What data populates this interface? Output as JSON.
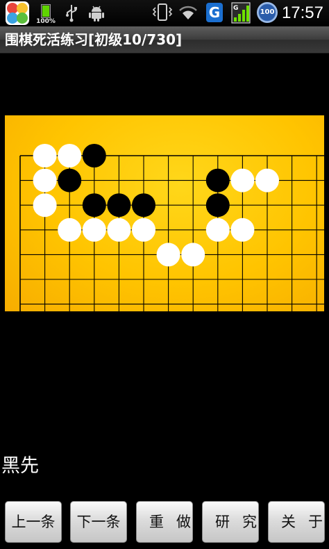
{
  "status_bar": {
    "battery_label": "100%",
    "battery_level": 1.0,
    "g_label": "G",
    "signal_label": "G",
    "badge_label": "100",
    "time": "17:57",
    "icons": [
      "app-store-icon",
      "battery-icon",
      "usb-icon",
      "android-icon",
      "vibrate-icon",
      "wifi-icon",
      "g-icon",
      "signal-icon",
      "hundred-badge-icon"
    ]
  },
  "title_bar": {
    "title": "围棋死活练习[初级10/730]"
  },
  "board": {
    "columns": 13,
    "rows": 7,
    "open_right_edge": true,
    "open_bottom_edge": true,
    "colors": {
      "board": "#ffc400",
      "line": "#000000",
      "black_stone": "#000000",
      "white_stone": "#ffffff"
    },
    "stones": [
      {
        "color": "white",
        "col": 1,
        "row": 0
      },
      {
        "color": "white",
        "col": 2,
        "row": 0
      },
      {
        "color": "black",
        "col": 3,
        "row": 0
      },
      {
        "color": "white",
        "col": 1,
        "row": 1
      },
      {
        "color": "black",
        "col": 2,
        "row": 1
      },
      {
        "color": "black",
        "col": 8,
        "row": 1
      },
      {
        "color": "white",
        "col": 9,
        "row": 1
      },
      {
        "color": "white",
        "col": 10,
        "row": 1
      },
      {
        "color": "white",
        "col": 1,
        "row": 2
      },
      {
        "color": "black",
        "col": 3,
        "row": 2
      },
      {
        "color": "black",
        "col": 4,
        "row": 2
      },
      {
        "color": "black",
        "col": 5,
        "row": 2
      },
      {
        "color": "black",
        "col": 8,
        "row": 2
      },
      {
        "color": "white",
        "col": 2,
        "row": 3
      },
      {
        "color": "white",
        "col": 3,
        "row": 3
      },
      {
        "color": "white",
        "col": 4,
        "row": 3
      },
      {
        "color": "white",
        "col": 5,
        "row": 3
      },
      {
        "color": "white",
        "col": 8,
        "row": 3
      },
      {
        "color": "white",
        "col": 9,
        "row": 3
      },
      {
        "color": "white",
        "col": 6,
        "row": 4
      },
      {
        "color": "white",
        "col": 7,
        "row": 4
      }
    ]
  },
  "to_move": "黑先",
  "buttons": {
    "prev": "上一条",
    "next": "下一条",
    "reset": "重做",
    "study": "研究",
    "about": "关于"
  }
}
